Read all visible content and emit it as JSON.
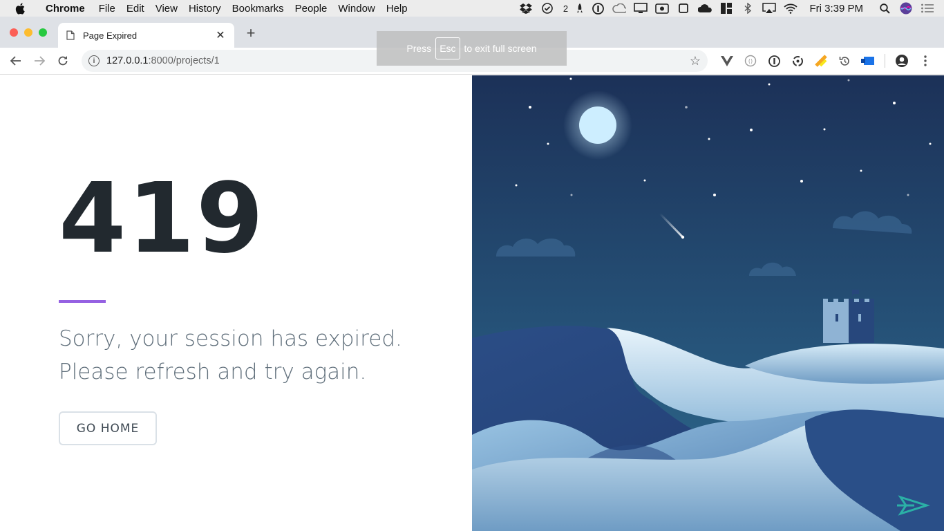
{
  "menubar": {
    "app_name": "Chrome",
    "items": [
      "File",
      "Edit",
      "View",
      "History",
      "Bookmarks",
      "People",
      "Window",
      "Help"
    ],
    "status_badge": "2",
    "clock": "Fri 3:39 PM"
  },
  "tab": {
    "title": "Page Expired"
  },
  "fullscreen_toast": {
    "prefix": "Press",
    "key": "Esc",
    "suffix": "to exit full screen"
  },
  "address_bar": {
    "host": "127.0.0.1",
    "path": ":8000/projects/1"
  },
  "error_page": {
    "code": "419",
    "message_line1": "Sorry, your session has expired.",
    "message_line2": "Please refresh and try again.",
    "button_label": "GO HOME"
  },
  "colors": {
    "accent": "#9561e2",
    "heading": "#22292f",
    "message": "#606f7b",
    "sky_top": "#1c3158",
    "sky_bottom": "#2e6a8c"
  }
}
